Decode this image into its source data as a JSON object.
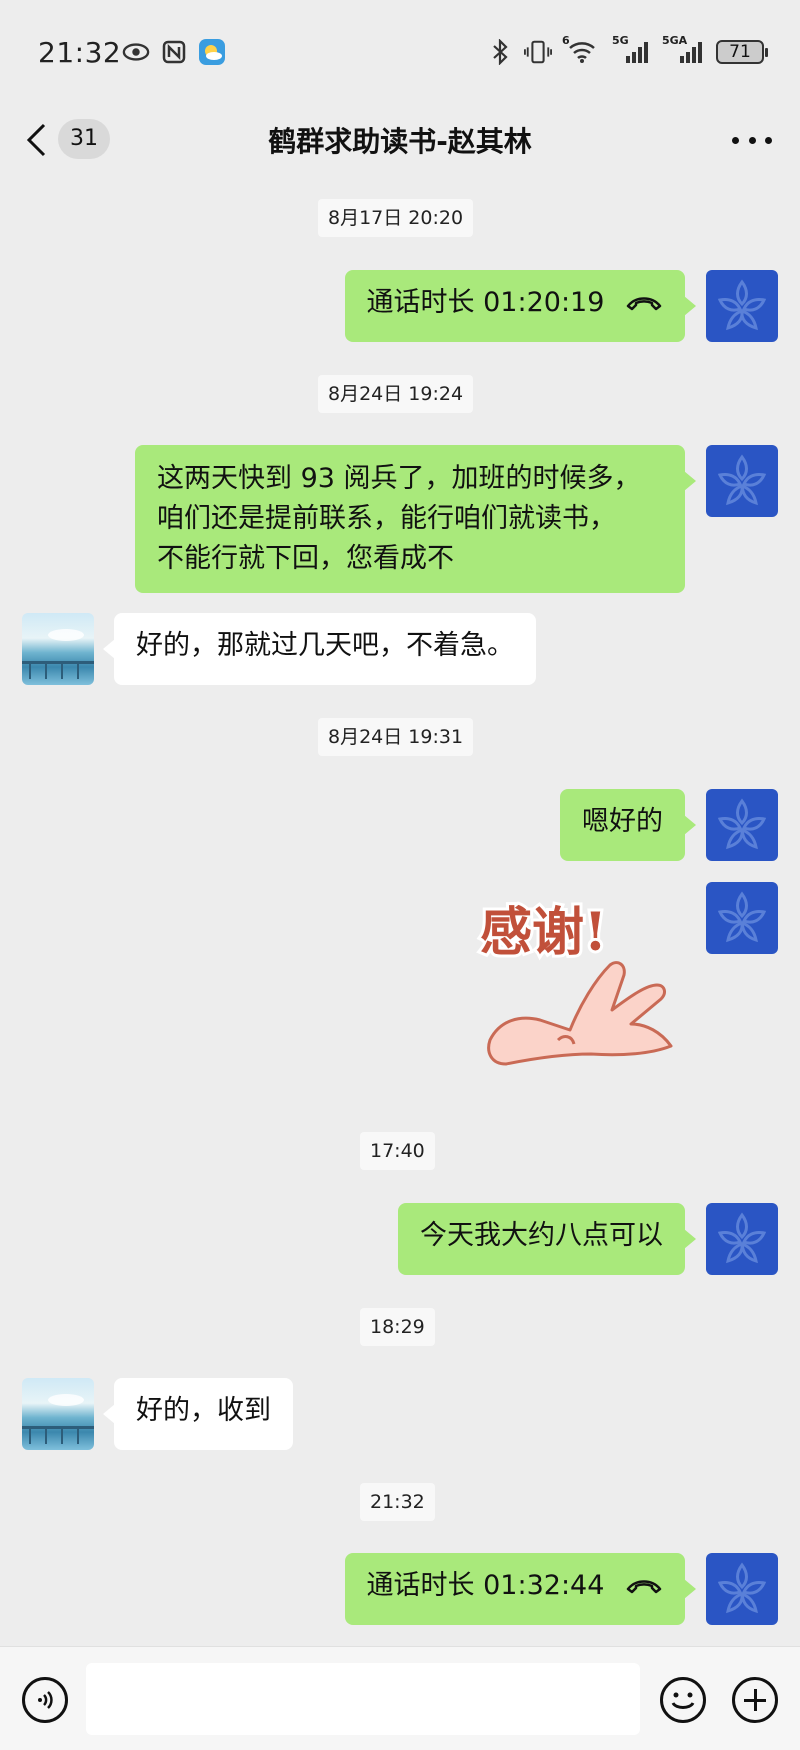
{
  "status_bar": {
    "time": "21:32",
    "network_1": "5G",
    "network_2": "5GA",
    "wifi_tag": "6",
    "battery": "71"
  },
  "header": {
    "unread_count": "31",
    "title": "鹤群求助读书-赵其林"
  },
  "messages": {
    "ts1": "8月17日 20:20",
    "call1": "通话时长 01:20:19",
    "ts2": "8月24日 19:24",
    "msg1_line1": "这两天快到 93 阅兵了，加班的时候多，",
    "msg1_line2": "咱们还是提前联系，能行咱们就读书，",
    "msg1_line3": "不能行就下回，您看成不",
    "reply1": "好的，那就过几天吧，不着急。",
    "ts3": "8月24日 19:31",
    "msg2": "嗯好的",
    "sticker_text": "感谢!",
    "ts4": "17:40",
    "msg3": "今天我大约八点可以",
    "ts5": "18:29",
    "reply2": "好的，收到",
    "ts6": "21:32",
    "call2": "通话时长 01:32:44"
  },
  "input": {
    "placeholder": ""
  },
  "colors": {
    "background": "#ededed",
    "outgoing_bubble": "#a9e97b",
    "incoming_bubble": "#ffffff",
    "my_avatar": "#2a55c4"
  }
}
